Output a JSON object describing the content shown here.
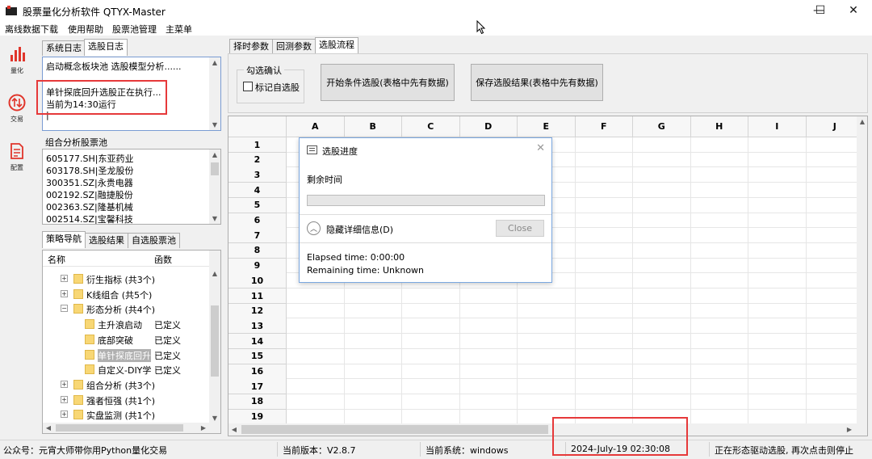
{
  "window": {
    "title": "股票量化分析软件 QTYX-Master",
    "minimize_icon": "—",
    "maximize_icon": "☐",
    "close_icon": "✕"
  },
  "menu": [
    "离线数据下载",
    "使用帮助",
    "股票池管理",
    "主菜单"
  ],
  "toolbar": [
    {
      "label": "量化",
      "icon": "bar-chart-icon",
      "color": "#e0352b"
    },
    {
      "label": "交易",
      "icon": "swap-arrows-icon",
      "color": "#e0352b"
    },
    {
      "label": "配置",
      "icon": "document-icon",
      "color": "#e0352b"
    }
  ],
  "log_tabs": [
    "系统日志",
    "选股日志"
  ],
  "log_lines": [
    "启动概念板块池 选股模型分析......",
    "",
    "单针探底回升选股正在执行...",
    "当前为14:30运行"
  ],
  "portfolio": {
    "title": "组合分析股票池",
    "stocks": [
      "605177.SH|东亚药业",
      "603178.SH|圣龙股份",
      "300351.SZ|永贵电器",
      "002192.SZ|融捷股份",
      "002363.SZ|隆基机械",
      "002514.SZ|宝馨科技"
    ]
  },
  "nav_tabs": [
    "策略导航",
    "选股结果",
    "自选股票池"
  ],
  "tree": {
    "headers": [
      "名称",
      "函数"
    ],
    "rows": [
      {
        "level": 0,
        "expander": "+",
        "label": "衍生指标 (共3个)",
        "fn": ""
      },
      {
        "level": 0,
        "expander": "+",
        "label": "K线组合 (共5个)",
        "fn": ""
      },
      {
        "level": 0,
        "expander": "−",
        "label": "形态分析 (共4个)",
        "fn": ""
      },
      {
        "level": 1,
        "expander": "",
        "label": "主升浪启动",
        "fn": "已定义"
      },
      {
        "level": 1,
        "expander": "",
        "label": "底部突破",
        "fn": "已定义"
      },
      {
        "level": 1,
        "expander": "",
        "label": "单针探底回升",
        "fn": "已定义",
        "selected": true
      },
      {
        "level": 1,
        "expander": "",
        "label": "自定义-DIY学",
        "fn": "已定义"
      },
      {
        "level": 0,
        "expander": "+",
        "label": "组合分析 (共3个)",
        "fn": ""
      },
      {
        "level": 0,
        "expander": "+",
        "label": "强者恒强 (共1个)",
        "fn": ""
      },
      {
        "level": 0,
        "expander": "+",
        "label": "实盘监测 (共1个)",
        "fn": ""
      }
    ]
  },
  "main_tabs": [
    "择时参数",
    "回测参数",
    "选股流程"
  ],
  "actions": {
    "group_title": "勾选确认",
    "checkbox_label": "标记自选股",
    "start_button": "开始条件选股(表格中先有数据)",
    "save_button": "保存选股结果(表格中先有数据)"
  },
  "grid": {
    "columns": [
      "A",
      "B",
      "C",
      "D",
      "E",
      "F",
      "G",
      "H",
      "I",
      "J"
    ],
    "rows": [
      "1",
      "2",
      "3",
      "4",
      "5",
      "6",
      "7",
      "8",
      "9",
      "10",
      "11",
      "12",
      "13",
      "14",
      "15",
      "16",
      "17",
      "18",
      "19"
    ]
  },
  "progress_dialog": {
    "title": "选股进度",
    "remaining_label": "剩余时间",
    "progress": 0,
    "details_toggle": "隐藏详细信息(D)",
    "close_button": "Close",
    "elapsed": "Elapsed time: 0:00:00",
    "remaining": "Remaining time: Unknown"
  },
  "status": {
    "wechat": "公众号：元宵大师带你用Python量化交易",
    "version": "当前版本：V2.8.7",
    "system": "当前系统：windows",
    "datetime": "2024-July-19 02:30:08",
    "message": "正在形态驱动选股, 再次点击则停止"
  }
}
